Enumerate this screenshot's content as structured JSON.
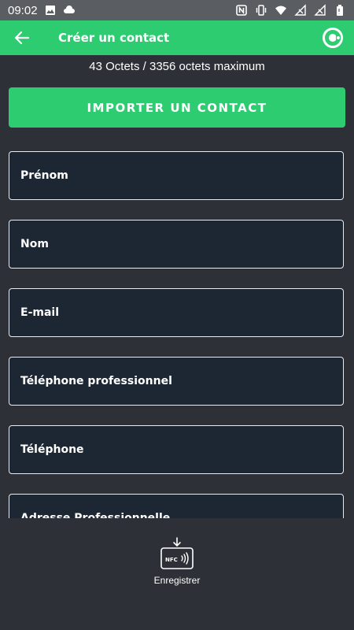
{
  "status_bar": {
    "time": "09:02",
    "left_icons": [
      "image-icon",
      "cloud-icon"
    ],
    "right_icons": [
      "nfc-icon",
      "vibrate-icon",
      "wifi-icon",
      "signal-icon",
      "signal-icon",
      "battery-icon"
    ]
  },
  "app_bar": {
    "title": "Créer un contact",
    "back_icon": "arrow-left-icon",
    "brand_icon": "brand-logo-icon",
    "color": "#2ecc71"
  },
  "size_info": "43 Octets / 3356 octets maximum",
  "import_button": {
    "label": "IMPORTER UN CONTACT"
  },
  "fields": [
    {
      "label": "Prénom"
    },
    {
      "label": "Nom"
    },
    {
      "label": "E-mail"
    },
    {
      "label": "Téléphone professionnel"
    },
    {
      "label": "Téléphone"
    },
    {
      "label": "Adresse Professionnelle"
    }
  ],
  "bottom_bar": {
    "save_label": "Enregistrer",
    "nfc_text": "NFC",
    "save_icon": "nfc-write-icon"
  },
  "colors": {
    "accent": "#2ecc71",
    "background": "#2d3036",
    "field_background": "#1d2733",
    "status_bar": "#5a5d61"
  }
}
